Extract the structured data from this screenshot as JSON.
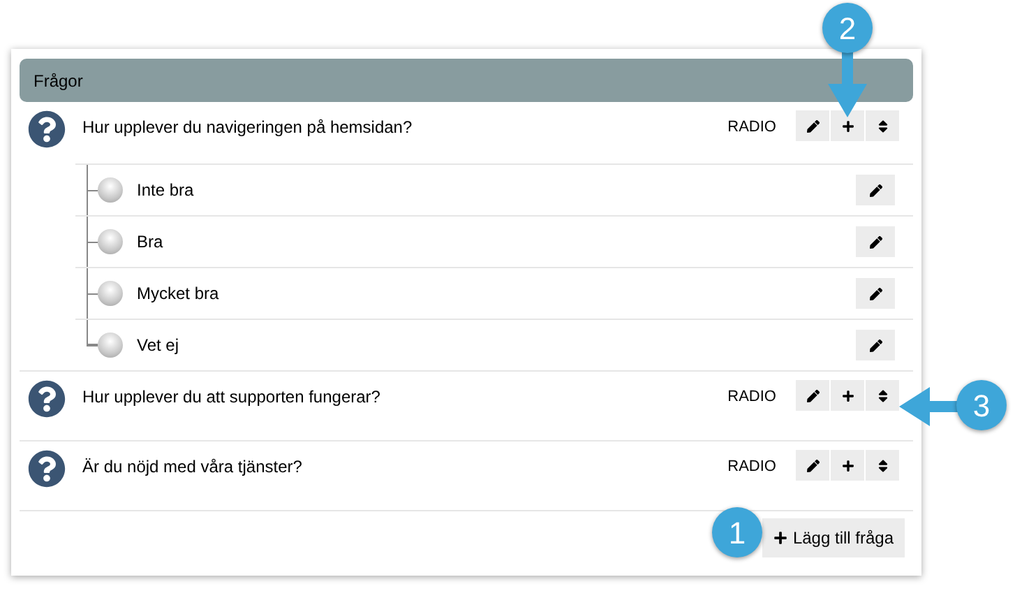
{
  "panel": {
    "title": "Frågor"
  },
  "questions": [
    {
      "text": "Hur upplever du navigeringen på hemsidan?",
      "type": "RADIO",
      "options": [
        {
          "label": "Inte bra"
        },
        {
          "label": "Bra"
        },
        {
          "label": "Mycket bra"
        },
        {
          "label": "Vet ej"
        }
      ]
    },
    {
      "text": "Hur upplever du att supporten fungerar?",
      "type": "RADIO"
    },
    {
      "text": "Är du nöjd med våra tjänster?",
      "type": "RADIO"
    }
  ],
  "add_button": "Lägg till fråga",
  "callouts": [
    {
      "number": "1",
      "kind": "none"
    },
    {
      "number": "2",
      "kind": "down"
    },
    {
      "number": "3",
      "kind": "left"
    }
  ]
}
